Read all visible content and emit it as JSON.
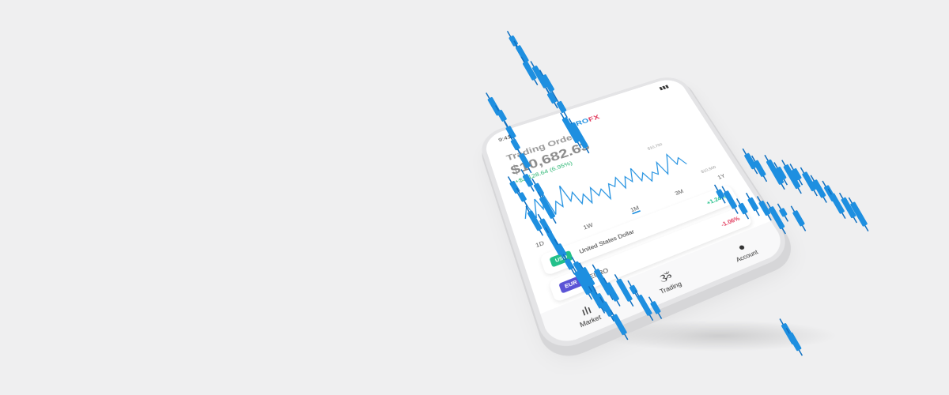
{
  "phone": {
    "status_time": "9:41",
    "logo_part1": "ERO",
    "logo_part2": "FX",
    "screen_title": "Trading Order",
    "balance": "$10,682.63",
    "change": "+$2,128.64 (6.95%)",
    "ranges": [
      "1D",
      "1W",
      "1M",
      "3M",
      "1Y"
    ],
    "active_range": 2,
    "markers": {
      "high": "$10,750",
      "low": "$10,500"
    },
    "currencies": [
      {
        "code": "USD",
        "name": "United States Dollar",
        "change": "+1.24%",
        "color": "#22c08a",
        "change_color": "#22c08a"
      },
      {
        "code": "EUR",
        "name": "EURO",
        "change": "-1.06%",
        "color": "#5b54d6",
        "change_color": "#e13a5c"
      }
    ],
    "tabs": [
      {
        "label": "Market",
        "icon": "candlestick-icon"
      },
      {
        "label": "Trading",
        "icon": "trading-icon"
      },
      {
        "label": "Account",
        "icon": "user-icon"
      }
    ]
  },
  "colors": {
    "candle": "#1e8fe0",
    "candle_dark": "#0f6fc0",
    "background": "#efeff0"
  }
}
